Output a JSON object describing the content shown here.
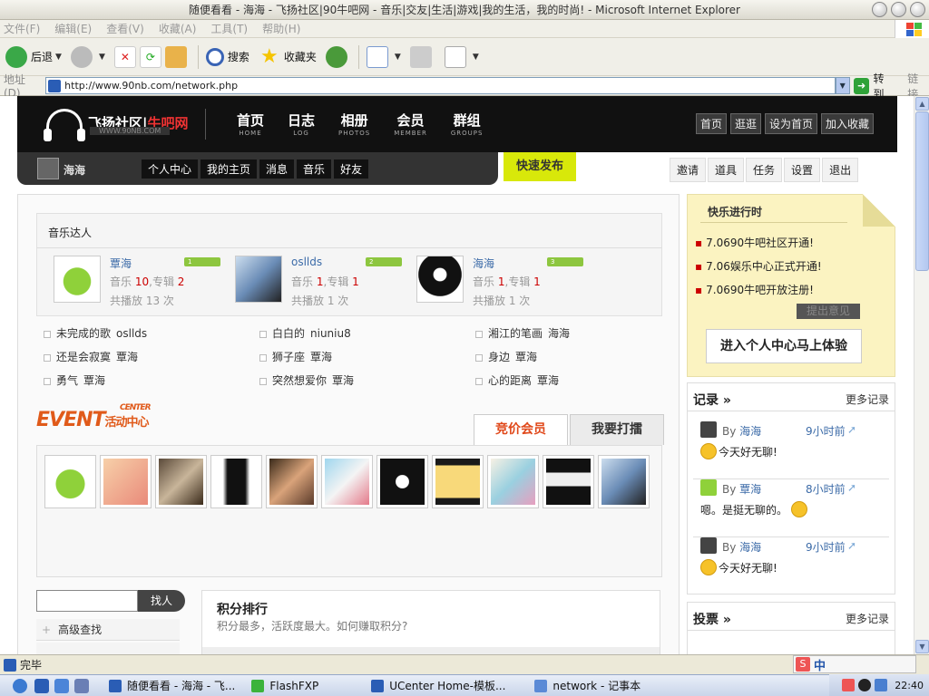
{
  "window": {
    "title": "随便看看 - 海海 - 飞扬社区|90牛吧网 - 音乐|交友|生活|游戏|我的生活，我的时尚! - Microsoft Internet Explorer"
  },
  "menubar": [
    "文件(F)",
    "编辑(E)",
    "查看(V)",
    "收藏(A)",
    "工具(T)",
    "帮助(H)"
  ],
  "toolbar": {
    "back": "后退",
    "search": "搜索",
    "favorites": "收藏夹"
  },
  "address": {
    "label": "地址(D)",
    "url": "http://www.90nb.com/network.php",
    "go": "转到",
    "links": "链接"
  },
  "site": {
    "logo_text_a": "飞扬社区",
    "logo_text_b": "牛吧网",
    "logo_sub": "WWW.90NB.COM",
    "nav": [
      {
        "cn": "首页",
        "en": "HOME"
      },
      {
        "cn": "日志",
        "en": "LOG"
      },
      {
        "cn": "相册",
        "en": "PHOTOS"
      },
      {
        "cn": "会员",
        "en": "MEMBER"
      },
      {
        "cn": "群组",
        "en": "GROUPS"
      }
    ],
    "header_links": [
      "首页",
      "逛逛",
      "设为首页",
      "加入收藏"
    ],
    "username": "海海",
    "user_links": [
      "个人中心",
      "我的主页",
      "消息",
      "音乐",
      "好友"
    ],
    "quick_publish": "快速发布",
    "right_menu": [
      "邀请",
      "道具",
      "任务",
      "设置",
      "退出"
    ]
  },
  "music": {
    "title": "音乐达人",
    "artists": [
      {
        "name": "覃海",
        "rank": "1",
        "music_label": "音乐",
        "music": "10",
        "album_label": "专辑",
        "albums": "2",
        "plays_label": "共播放",
        "plays": "13 次"
      },
      {
        "name": "osllds",
        "rank": "2",
        "music_label": "音乐",
        "music": "1",
        "album_label": "专辑",
        "albums": "1",
        "plays_label": "共播放",
        "plays": "1 次"
      },
      {
        "name": "海海",
        "rank": "3",
        "music_label": "音乐",
        "music": "1",
        "album_label": "专辑",
        "albums": "1",
        "plays_label": "共播放",
        "plays": "1 次"
      }
    ],
    "songs": [
      {
        "title": "未完成的歌",
        "by": "osllds"
      },
      {
        "title": "白白的",
        "by": "niuniu8"
      },
      {
        "title": "湘江的笔画",
        "by": "海海"
      },
      {
        "title": "还是会寂寞",
        "by": "覃海"
      },
      {
        "title": "狮子座",
        "by": "覃海"
      },
      {
        "title": "身边",
        "by": "覃海"
      },
      {
        "title": "勇气",
        "by": "覃海"
      },
      {
        "title": "突然想爱你",
        "by": "覃海"
      },
      {
        "title": "心的距离",
        "by": "覃海"
      }
    ]
  },
  "event": {
    "logo_main": "EVENT",
    "logo_center": "CENTER",
    "logo_cn": "活动中心",
    "tabs": [
      "竞价会员",
      "我要打擂"
    ]
  },
  "search": {
    "button": "找人",
    "advanced": "高级查找"
  },
  "points": {
    "title": "积分排行",
    "subtitle": "积分最多，活跃度最大。如何赚取积分?"
  },
  "happy": {
    "title": "快乐进行时",
    "news": [
      "7.0690牛吧社区开通!",
      "7.06娱乐中心正式开通!",
      "7.0690牛吧开放注册!"
    ],
    "feedback": "提出意见",
    "enter": "进入个人中心马上体验"
  },
  "records": {
    "title": "记录",
    "more": "更多记录",
    "items": [
      {
        "by_prefix": "By",
        "user": "海海",
        "time": "9小时前",
        "msg": "今天好无聊!"
      },
      {
        "by_prefix": "By",
        "user": "覃海",
        "time": "8小时前",
        "msg": "嗯。是挺无聊的。"
      },
      {
        "by_prefix": "By",
        "user": "海海",
        "time": "9小时前",
        "msg": "今天好无聊!"
      }
    ]
  },
  "vote": {
    "title": "投票",
    "more": "更多记录"
  },
  "status": {
    "text": "完毕"
  },
  "taskbar": {
    "tasks": [
      "随便看看 - 海海 - 飞...",
      "FlashFXP",
      "UCenter Home-模板...",
      "network - 记事本"
    ],
    "ime": "中",
    "clock": "22:40"
  }
}
